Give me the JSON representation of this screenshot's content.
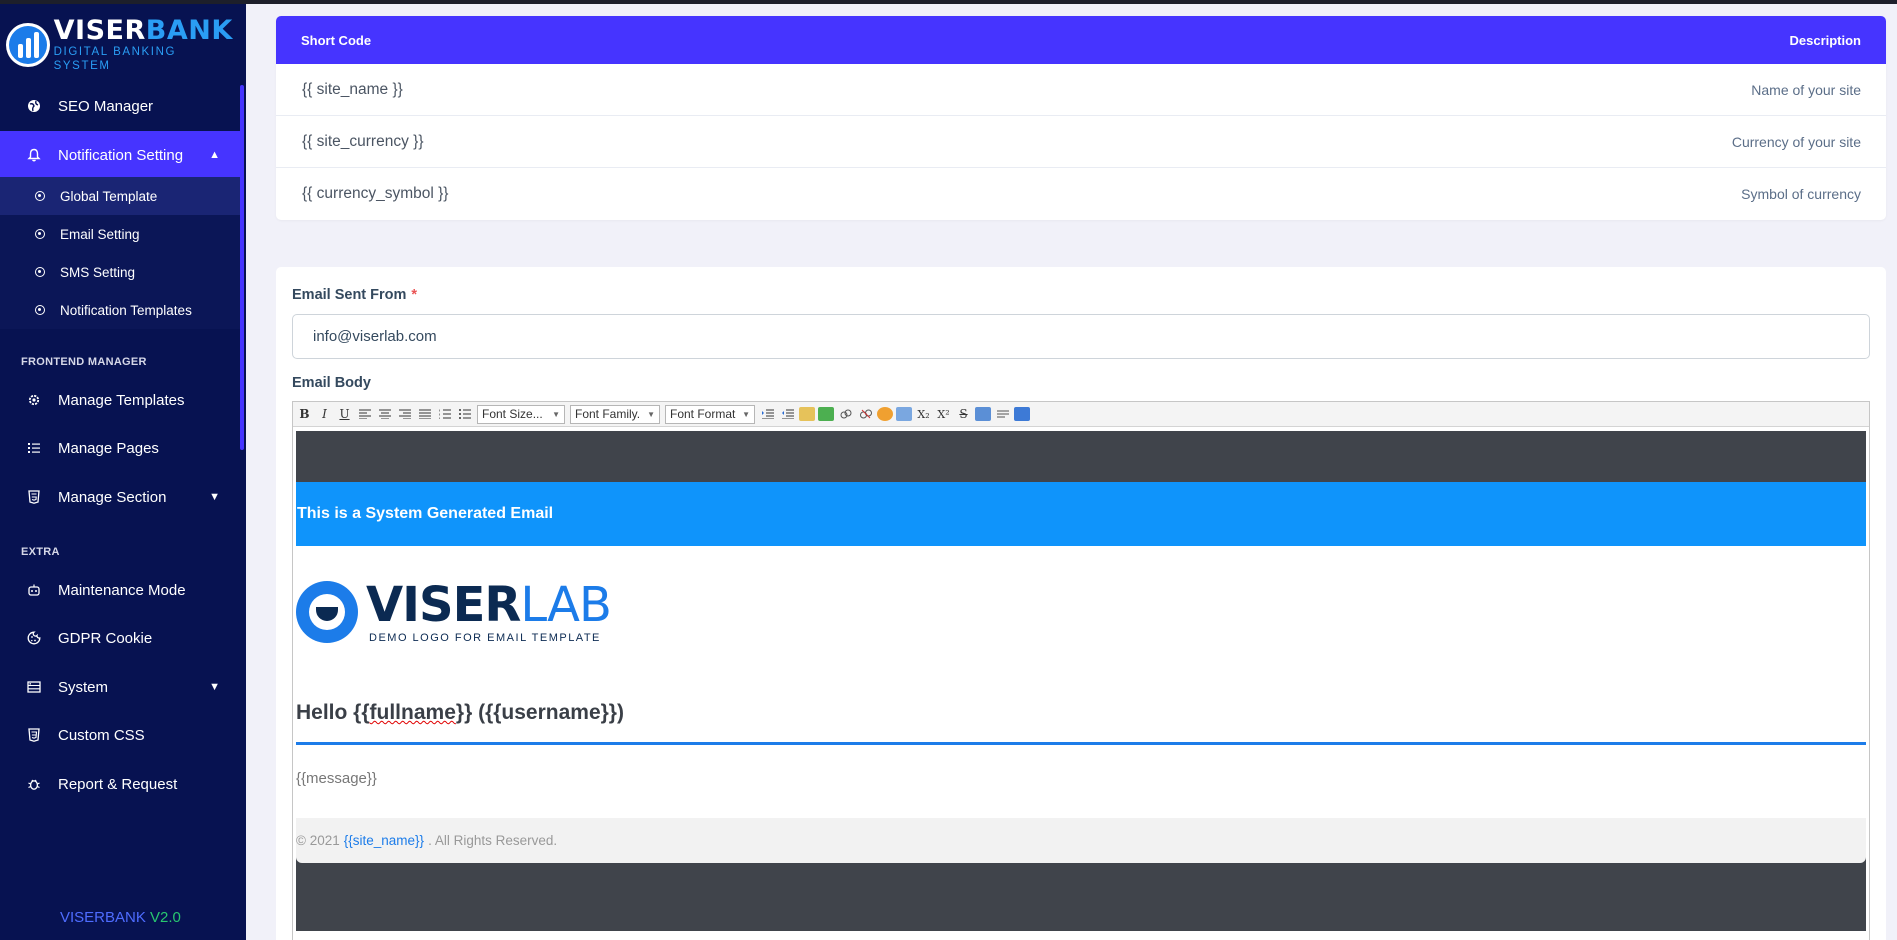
{
  "brand": {
    "name_part1": "VISER",
    "name_part2": "BANK",
    "subtitle": "DIGITAL BANKING SYSTEM",
    "version_name": "VISERBANK",
    "version_number": "V2.0"
  },
  "sidebar": {
    "items": [
      {
        "label": "SEO Manager",
        "icon": "globe-icon"
      },
      {
        "label": "Notification Setting",
        "icon": "bell-icon"
      },
      {
        "label": "Manage Templates",
        "icon": "gear-icon"
      },
      {
        "label": "Manage Pages",
        "icon": "list-icon"
      },
      {
        "label": "Manage Section",
        "icon": "html5-icon"
      },
      {
        "label": "Maintenance Mode",
        "icon": "robot-icon"
      },
      {
        "label": "GDPR Cookie",
        "icon": "cookie-icon"
      },
      {
        "label": "System",
        "icon": "server-icon"
      },
      {
        "label": "Custom CSS",
        "icon": "css3-icon"
      },
      {
        "label": "Report & Request",
        "icon": "bug-icon"
      }
    ],
    "submenu": [
      {
        "label": "Global Template"
      },
      {
        "label": "Email Setting"
      },
      {
        "label": "SMS Setting"
      },
      {
        "label": "Notification Templates"
      }
    ],
    "sections": {
      "frontend": "FRONTEND MANAGER",
      "extra": "EXTRA"
    }
  },
  "shortcodes": {
    "header_code": "Short Code",
    "header_desc": "Description",
    "rows": [
      {
        "code": "{{ site_name }}",
        "desc": "Name of your site"
      },
      {
        "code": "{{ site_currency }}",
        "desc": "Currency of your site"
      },
      {
        "code": "{{ currency_symbol }}",
        "desc": "Symbol of currency"
      }
    ]
  },
  "form": {
    "email_from_label": "Email Sent From",
    "required_mark": "*",
    "email_from_value": "info@viserlab.com",
    "email_body_label": "Email Body"
  },
  "toolbar": {
    "bold": "B",
    "italic": "I",
    "underline": "U",
    "font_size": "Font Size...",
    "font_family": "Font Family.",
    "font_format": "Font Format",
    "subscript": "X₂",
    "superscript": "X²",
    "strike": "S"
  },
  "template": {
    "banner": "This is a System Generated Email",
    "logo_part1": "VISER",
    "logo_part2": "LAB",
    "logo_sub": "DEMO LOGO FOR EMAIL TEMPLATE",
    "hello_prefix": "Hello {{",
    "hello_fullname": "fullname",
    "hello_suffix": "}} ({{username}})",
    "message": "{{message}}",
    "footer_prefix": "© 2021",
    "footer_site": "{{site_name}}",
    "footer_suffix": ". All Rights Reserved."
  }
}
